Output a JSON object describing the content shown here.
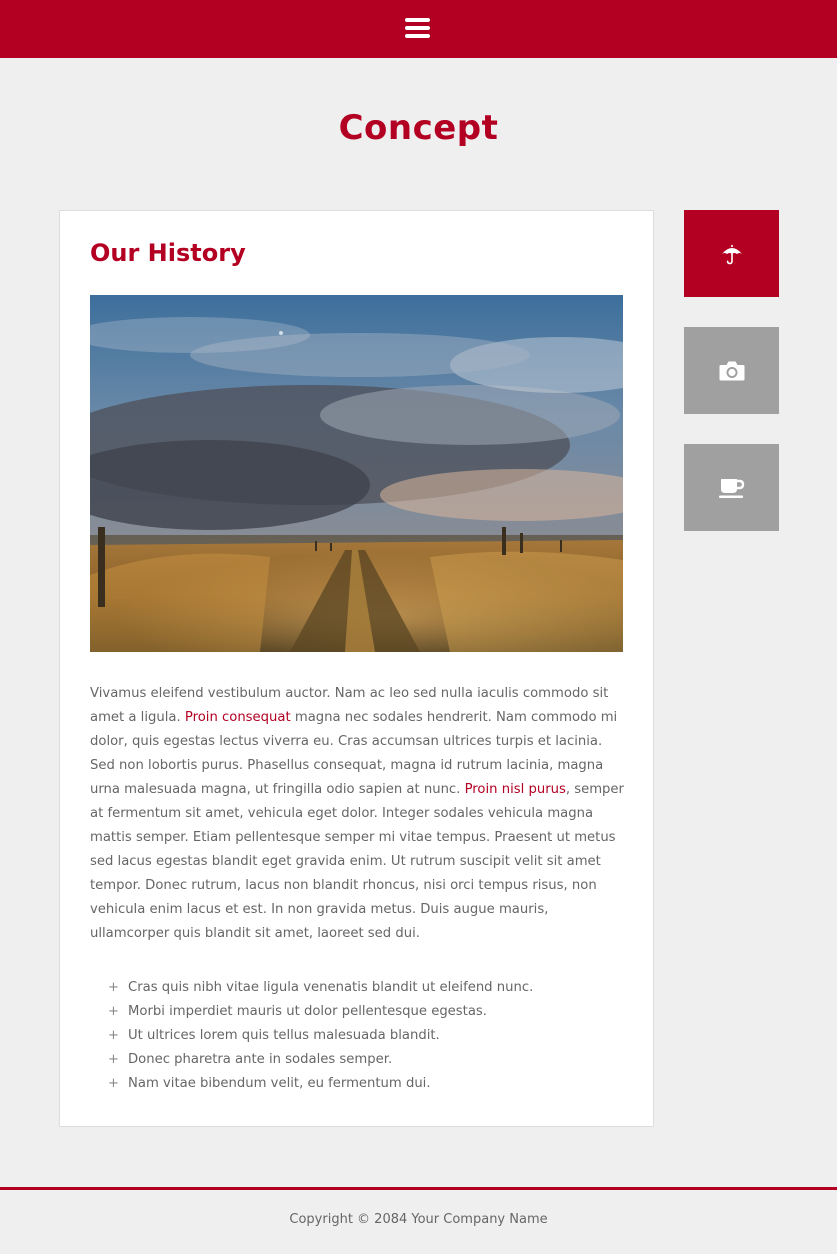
{
  "header": {
    "menu_icon": "hamburger-icon",
    "brand_color": "#b30022"
  },
  "page": {
    "title": "Concept"
  },
  "article": {
    "title": "Our History",
    "image": "landscape-photo-grass-field-path-cloudy-sky",
    "paragraph": {
      "part1": "Vivamus eleifend vestibulum auctor. Nam ac leo sed nulla iaculis commodo sit amet a ligula. ",
      "link1": "Proin consequat",
      "part2": " magna nec sodales hendrerit. Nam commodo mi dolor, quis egestas lectus viverra eu. Cras accumsan ultrices turpis et lacinia. Sed non lobortis purus. Phasellus consequat, magna id rutrum lacinia, magna urna malesuada magna, ut fringilla odio sapien at nunc. ",
      "link2": "Proin nisl purus",
      "part3": ", semper at fermentum sit amet, vehicula eget dolor. Integer sodales vehicula magna mattis semper. Etiam pellentesque semper mi vitae tempus. Praesent ut metus sed lacus egestas blandit eget gravida enim. Ut rutrum suscipit velit sit amet tempor. Donec rutrum, lacus non blandit rhoncus, nisi orci tempus risus, non vehicula enim lacus et est. In non gravida metus. Duis augue mauris, ullamcorper quis blandit sit amet, laoreet sed dui."
    },
    "list_marker": "+",
    "list": [
      "Cras quis nibh vitae ligula venenatis blandit ut eleifend nunc.",
      "Morbi imperdiet mauris ut dolor pellentesque egestas.",
      "Ut ultrices lorem quis tellus malesuada blandit.",
      "Donec pharetra ante in sodales semper.",
      "Nam vitae bibendum velit, eu fermentum dui."
    ]
  },
  "sidebar": {
    "buttons": [
      {
        "icon": "umbrella-icon",
        "active": true
      },
      {
        "icon": "camera-icon",
        "active": false
      },
      {
        "icon": "coffee-cup-icon",
        "active": false
      }
    ]
  },
  "footer": {
    "copyright": "Copyright © 2084 Your Company Name"
  }
}
